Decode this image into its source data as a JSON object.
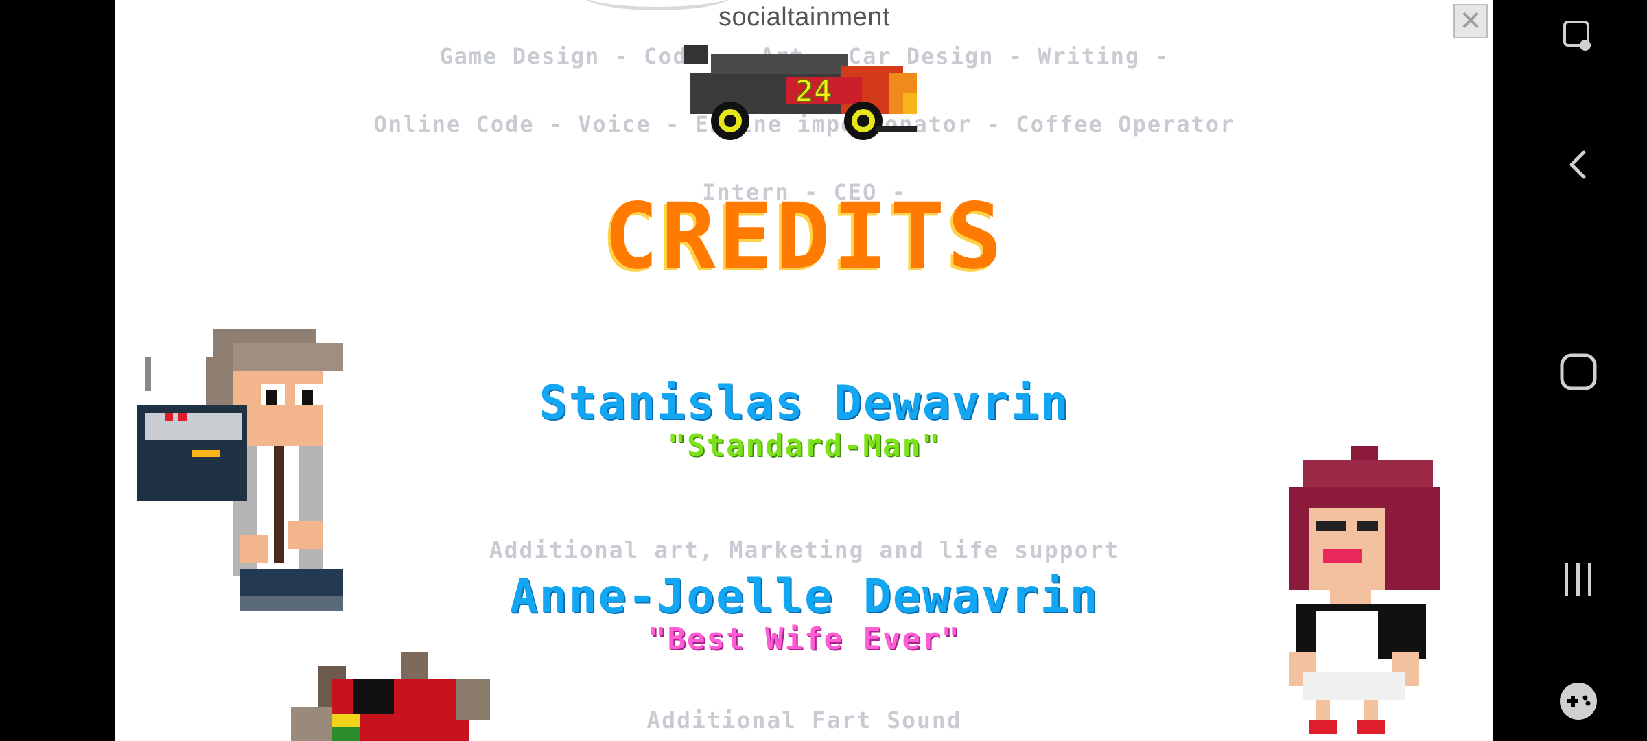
{
  "logo": {
    "text": "socialtainment"
  },
  "credits": {
    "title": "CREDITS",
    "roles_lines": [
      "Game Design - Code -  Art - Car Design - Writing -",
      "Online Code - Voice - Engine impersonator - Coffee Operator",
      "Intern - CEO -"
    ],
    "person1": {
      "name": "Stanislas Dewavrin",
      "nickname": "\"Standard-Man\""
    },
    "section2_label": "Additional art, Marketing and life support",
    "person2": {
      "name": "Anne-Joelle Dewavrin",
      "nickname": "\"Best Wife Ever\""
    },
    "section3_label": "Additional Fart Sound"
  },
  "car": {
    "number": "24"
  },
  "colors": {
    "title_orange": "#ff7a00",
    "title_shadow": "#ffd24a",
    "name_blue": "#13a7f3",
    "nick_green": "#7ee21a",
    "nick_pink": "#ff5cd6",
    "role_gray": "#c8ccd2"
  },
  "navigation": {
    "icons": [
      "screen-touch-icon",
      "back-icon",
      "home-icon",
      "recents-icon",
      "game-controller-icon"
    ]
  }
}
